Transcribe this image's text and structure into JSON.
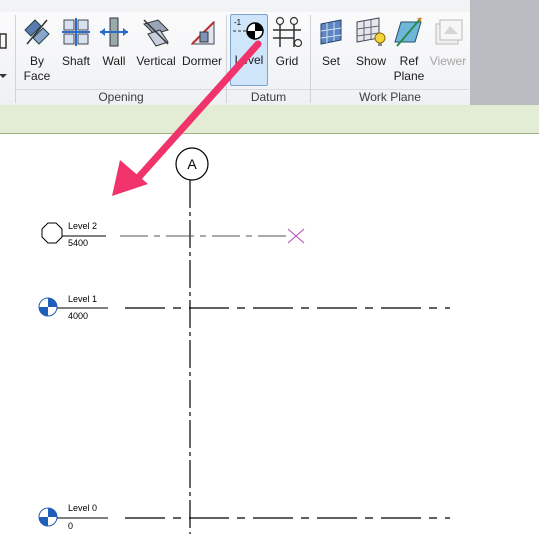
{
  "ribbon": {
    "buttons": [
      {
        "label": "By\nFace"
      },
      {
        "label": "Shaft"
      },
      {
        "label": "Wall"
      },
      {
        "label": "Vertical"
      },
      {
        "label": "Dormer"
      },
      {
        "label": "Level"
      },
      {
        "label": "Grid"
      },
      {
        "label": "Set"
      },
      {
        "label": "Show"
      },
      {
        "label": "Ref\nPlane"
      },
      {
        "label": "Viewer"
      }
    ],
    "panels": {
      "opening": "Opening",
      "datum": "Datum",
      "work_plane": "Work Plane"
    }
  },
  "canvas": {
    "grid_bubble": "A",
    "levels": [
      {
        "name": "Level 2",
        "elevation": "5400"
      },
      {
        "name": "Level 1",
        "elevation": "4000"
      },
      {
        "name": "Level 0",
        "elevation": "0"
      }
    ],
    "level_icon_value": "-1"
  },
  "colors": {
    "arrow": "#f0336a",
    "active_button": "#cfe5fa",
    "level_marker": "#1f5fb8",
    "green_bar": "#e3ecd5"
  }
}
